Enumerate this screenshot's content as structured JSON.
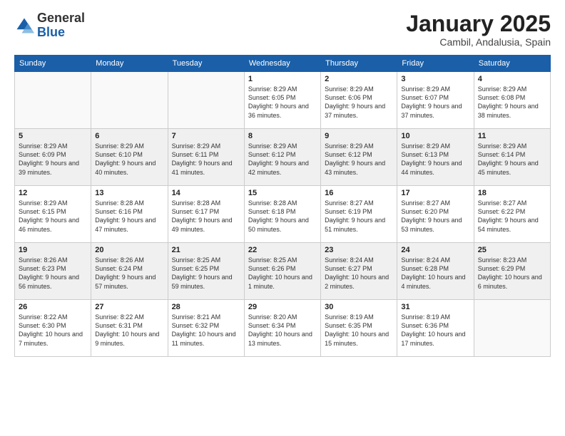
{
  "header": {
    "logo_general": "General",
    "logo_blue": "Blue",
    "month_title": "January 2025",
    "location": "Cambil, Andalusia, Spain"
  },
  "weekdays": [
    "Sunday",
    "Monday",
    "Tuesday",
    "Wednesday",
    "Thursday",
    "Friday",
    "Saturday"
  ],
  "weeks": [
    [
      {
        "day": "",
        "info": ""
      },
      {
        "day": "",
        "info": ""
      },
      {
        "day": "",
        "info": ""
      },
      {
        "day": "1",
        "info": "Sunrise: 8:29 AM\nSunset: 6:05 PM\nDaylight: 9 hours and 36 minutes."
      },
      {
        "day": "2",
        "info": "Sunrise: 8:29 AM\nSunset: 6:06 PM\nDaylight: 9 hours and 37 minutes."
      },
      {
        "day": "3",
        "info": "Sunrise: 8:29 AM\nSunset: 6:07 PM\nDaylight: 9 hours and 37 minutes."
      },
      {
        "day": "4",
        "info": "Sunrise: 8:29 AM\nSunset: 6:08 PM\nDaylight: 9 hours and 38 minutes."
      }
    ],
    [
      {
        "day": "5",
        "info": "Sunrise: 8:29 AM\nSunset: 6:09 PM\nDaylight: 9 hours and 39 minutes."
      },
      {
        "day": "6",
        "info": "Sunrise: 8:29 AM\nSunset: 6:10 PM\nDaylight: 9 hours and 40 minutes."
      },
      {
        "day": "7",
        "info": "Sunrise: 8:29 AM\nSunset: 6:11 PM\nDaylight: 9 hours and 41 minutes."
      },
      {
        "day": "8",
        "info": "Sunrise: 8:29 AM\nSunset: 6:12 PM\nDaylight: 9 hours and 42 minutes."
      },
      {
        "day": "9",
        "info": "Sunrise: 8:29 AM\nSunset: 6:12 PM\nDaylight: 9 hours and 43 minutes."
      },
      {
        "day": "10",
        "info": "Sunrise: 8:29 AM\nSunset: 6:13 PM\nDaylight: 9 hours and 44 minutes."
      },
      {
        "day": "11",
        "info": "Sunrise: 8:29 AM\nSunset: 6:14 PM\nDaylight: 9 hours and 45 minutes."
      }
    ],
    [
      {
        "day": "12",
        "info": "Sunrise: 8:29 AM\nSunset: 6:15 PM\nDaylight: 9 hours and 46 minutes."
      },
      {
        "day": "13",
        "info": "Sunrise: 8:28 AM\nSunset: 6:16 PM\nDaylight: 9 hours and 47 minutes."
      },
      {
        "day": "14",
        "info": "Sunrise: 8:28 AM\nSunset: 6:17 PM\nDaylight: 9 hours and 49 minutes."
      },
      {
        "day": "15",
        "info": "Sunrise: 8:28 AM\nSunset: 6:18 PM\nDaylight: 9 hours and 50 minutes."
      },
      {
        "day": "16",
        "info": "Sunrise: 8:27 AM\nSunset: 6:19 PM\nDaylight: 9 hours and 51 minutes."
      },
      {
        "day": "17",
        "info": "Sunrise: 8:27 AM\nSunset: 6:20 PM\nDaylight: 9 hours and 53 minutes."
      },
      {
        "day": "18",
        "info": "Sunrise: 8:27 AM\nSunset: 6:22 PM\nDaylight: 9 hours and 54 minutes."
      }
    ],
    [
      {
        "day": "19",
        "info": "Sunrise: 8:26 AM\nSunset: 6:23 PM\nDaylight: 9 hours and 56 minutes."
      },
      {
        "day": "20",
        "info": "Sunrise: 8:26 AM\nSunset: 6:24 PM\nDaylight: 9 hours and 57 minutes."
      },
      {
        "day": "21",
        "info": "Sunrise: 8:25 AM\nSunset: 6:25 PM\nDaylight: 9 hours and 59 minutes."
      },
      {
        "day": "22",
        "info": "Sunrise: 8:25 AM\nSunset: 6:26 PM\nDaylight: 10 hours and 1 minute."
      },
      {
        "day": "23",
        "info": "Sunrise: 8:24 AM\nSunset: 6:27 PM\nDaylight: 10 hours and 2 minutes."
      },
      {
        "day": "24",
        "info": "Sunrise: 8:24 AM\nSunset: 6:28 PM\nDaylight: 10 hours and 4 minutes."
      },
      {
        "day": "25",
        "info": "Sunrise: 8:23 AM\nSunset: 6:29 PM\nDaylight: 10 hours and 6 minutes."
      }
    ],
    [
      {
        "day": "26",
        "info": "Sunrise: 8:22 AM\nSunset: 6:30 PM\nDaylight: 10 hours and 7 minutes."
      },
      {
        "day": "27",
        "info": "Sunrise: 8:22 AM\nSunset: 6:31 PM\nDaylight: 10 hours and 9 minutes."
      },
      {
        "day": "28",
        "info": "Sunrise: 8:21 AM\nSunset: 6:32 PM\nDaylight: 10 hours and 11 minutes."
      },
      {
        "day": "29",
        "info": "Sunrise: 8:20 AM\nSunset: 6:34 PM\nDaylight: 10 hours and 13 minutes."
      },
      {
        "day": "30",
        "info": "Sunrise: 8:19 AM\nSunset: 6:35 PM\nDaylight: 10 hours and 15 minutes."
      },
      {
        "day": "31",
        "info": "Sunrise: 8:19 AM\nSunset: 6:36 PM\nDaylight: 10 hours and 17 minutes."
      },
      {
        "day": "",
        "info": ""
      }
    ]
  ]
}
